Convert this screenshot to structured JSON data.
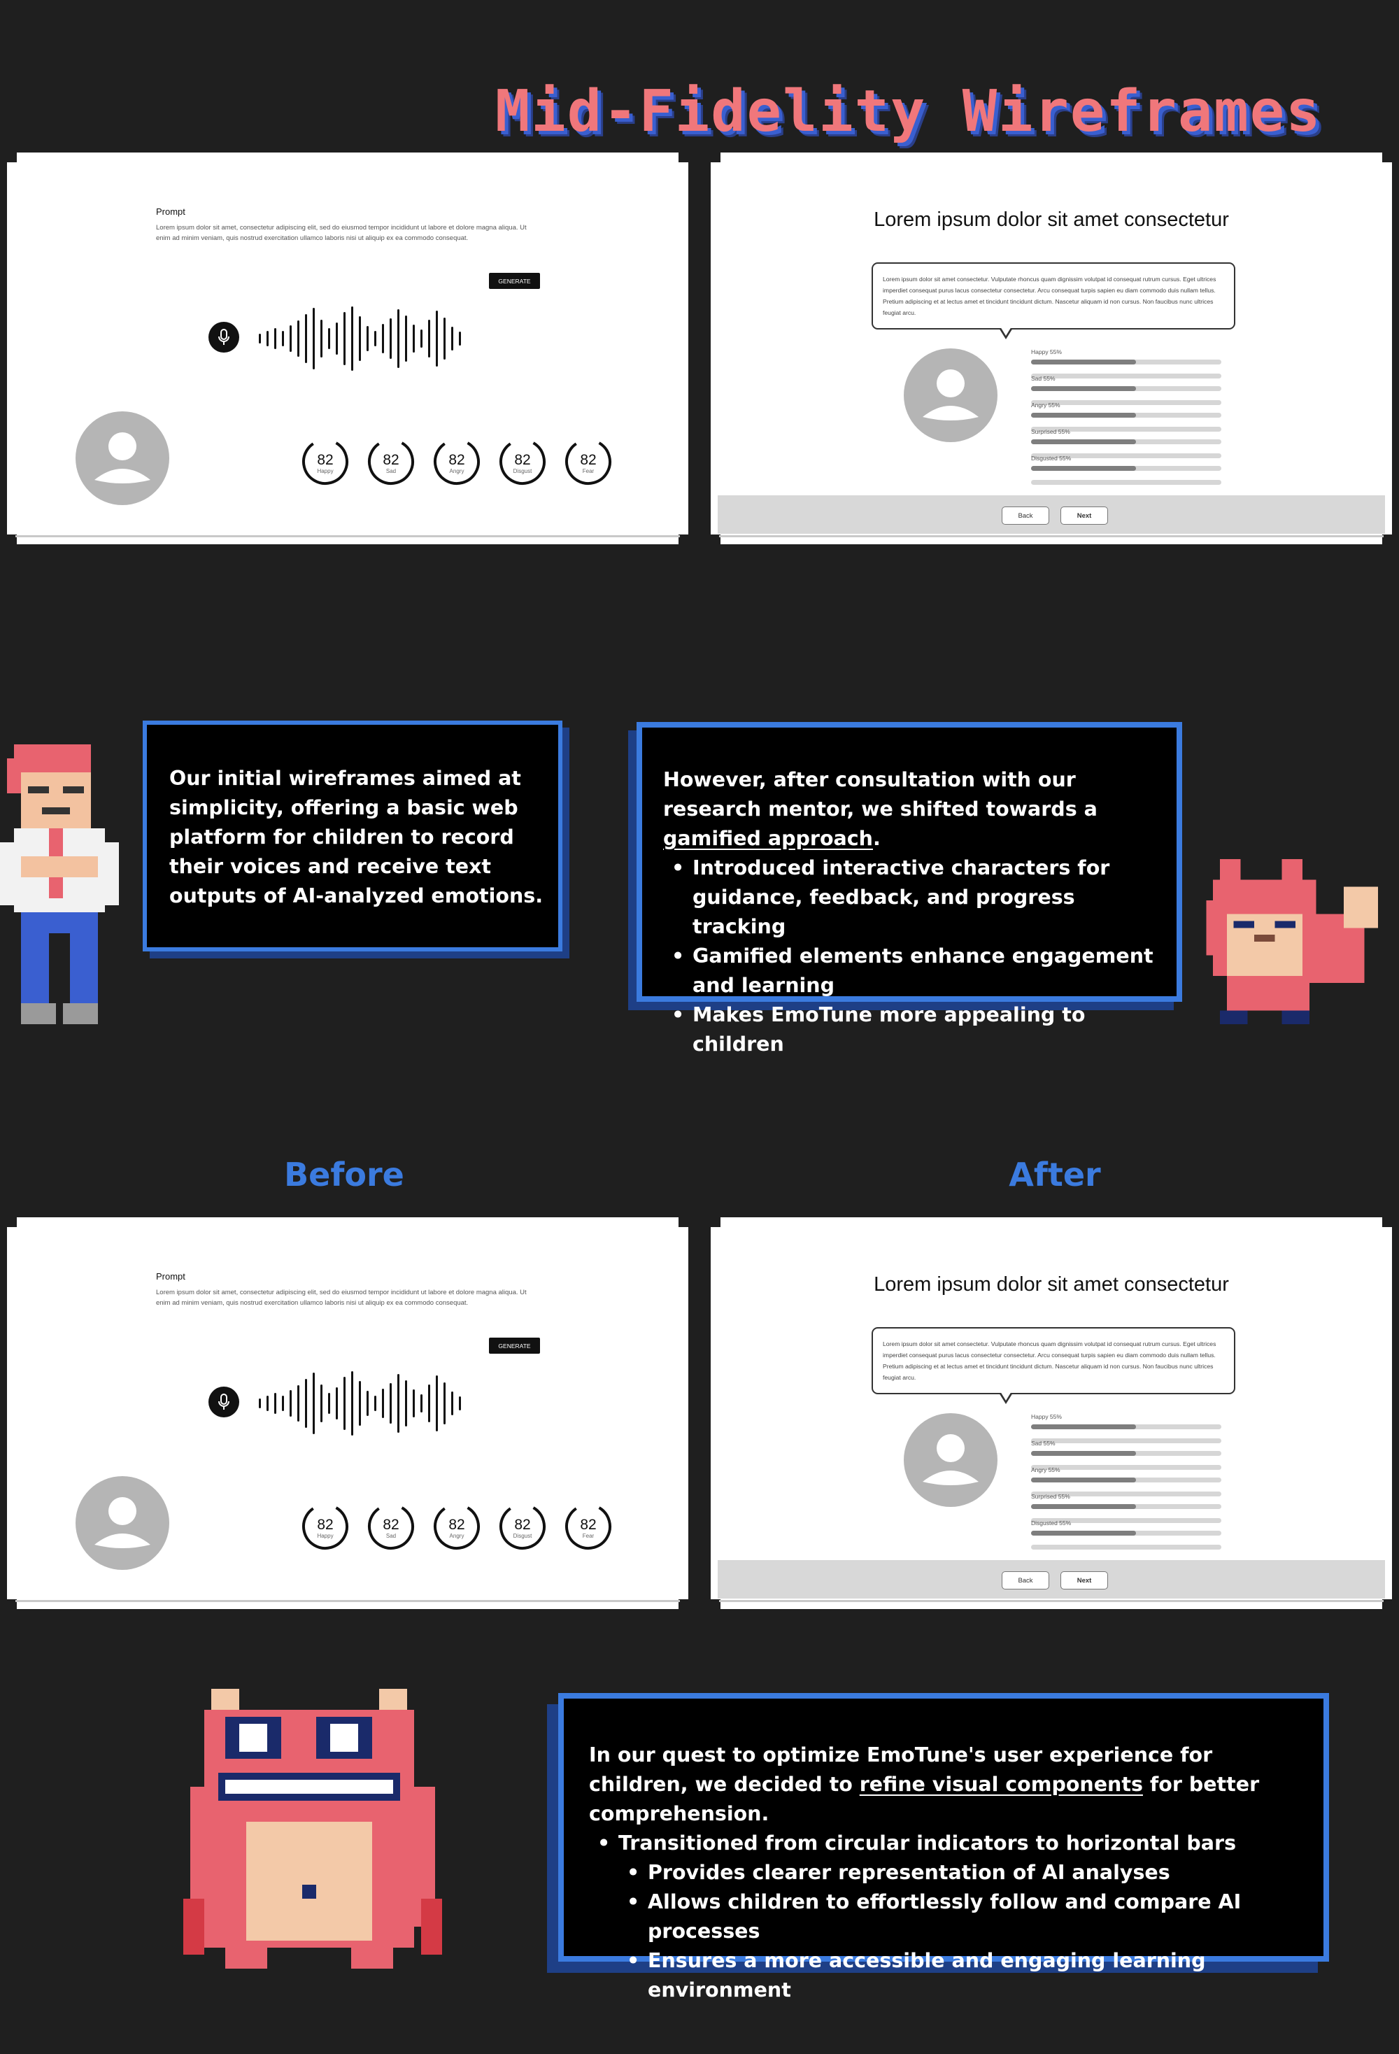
{
  "page": {
    "title": "Mid-Fidelity Wireframes"
  },
  "wireframe_before": {
    "prompt_label": "Prompt",
    "prompt_text": "Lorem ipsum dolor sit amet, consectetur adipiscing elit, sed do eiusmod tempor incididunt ut labore et dolore magna aliqua. Ut enim ad minim veniam, quis nostrud exercitation ullamco laboris nisi ut aliquip ex ea commodo consequat.",
    "generate_label": "GENERATE",
    "emotions": [
      {
        "value": "82",
        "label": "Happy"
      },
      {
        "value": "82",
        "label": "Sad"
      },
      {
        "value": "82",
        "label": "Angry"
      },
      {
        "value": "82",
        "label": "Disgust"
      },
      {
        "value": "82",
        "label": "Fear"
      }
    ]
  },
  "wireframe_after": {
    "title": "Lorem ipsum dolor sit amet consectetur",
    "bubble_text": "Lorem ipsum dolor sit amet consectetur. Vulputate rhoncus quam dignissim volutpat id consequat rutrum cursus. Eget ultrices imperdiet consequat purus lacus consectetur consectetur. Arcu consequat turpis sapien eu diam commodo duis nullam tellus. Pretium adipiscing et at lectus amet et tincidunt tincidunt dictum. Nascetur aliquam id non cursus. Non faucibus nunc ultrices feugiat arcu.",
    "bars": [
      {
        "label": "Happy 55%",
        "value": 0.55
      },
      {
        "label": "Sad 55%",
        "value": 0.55
      },
      {
        "label": "Angry 55%",
        "value": 0.55
      },
      {
        "label": "Surprised 55%",
        "value": 0.55
      },
      {
        "label": "Disgusted 55%",
        "value": 0.55
      }
    ],
    "back_label": "Back",
    "next_label": "Next"
  },
  "panel_initial": {
    "text": "Our initial wireframes aimed at simplicity, offering a basic web platform for children to record their voices and receive text outputs of AI-analyzed emotions."
  },
  "panel_gamified": {
    "intro_a": "However, after consultation with our research mentor, we shifted towards a ",
    "intro_link": "gamified approach",
    "intro_b": ".",
    "bullets": [
      "Introduced interactive characters for guidance, feedback, and progress tracking",
      "Gamified elements enhance engagement and learning",
      "Makes EmoTune more appealing to children"
    ]
  },
  "labels": {
    "before": "Before",
    "after": "After"
  },
  "panel_refine": {
    "intro_a": "In our quest to optimize EmoTune's user experience for children, we decided to ",
    "intro_link": "refine visual components",
    "intro_b": " for better comprehension.",
    "bullet": "Transitioned from circular indicators to horizontal bars",
    "sub_bullets": [
      "Provides clearer representation of AI analyses",
      "Allows children to effortlessly follow and compare AI processes",
      "Ensures a more accessible and engaging learning environment"
    ]
  },
  "colors": {
    "background": "#1f1f1f",
    "title_coral": "#f0777b",
    "accent_blue": "#3b7bdf",
    "panel_black": "#000000"
  },
  "icons": [
    "microphone-icon",
    "user-avatar-icon",
    "sound-wave-icon"
  ]
}
